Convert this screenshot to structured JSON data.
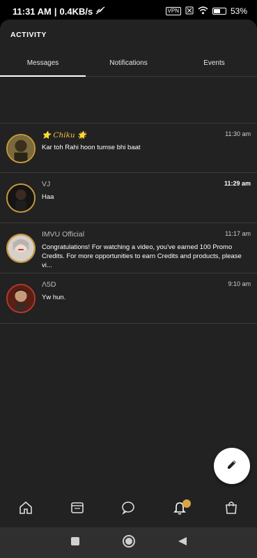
{
  "status_bar": {
    "time": "11:31 AM",
    "speed": "0.4KB/s",
    "vpn": "VPN",
    "battery": "53"
  },
  "header": {
    "title": "ACTIVITY"
  },
  "tabs": [
    {
      "label": "Messages",
      "active": true
    },
    {
      "label": "Notifications",
      "active": false
    },
    {
      "label": "Events",
      "active": false
    }
  ],
  "messages": [
    {
      "name": "⭐ Chiku 🌟",
      "time": "11:30 am",
      "text": "Kar toh Rahi hoon tumse bhi baat"
    },
    {
      "name": "VJ",
      "time": "11:29 am",
      "text": "Haa"
    },
    {
      "name": "IMVU Official",
      "time": "11:17 am",
      "text": "Congratulations! For watching a video, you've earned 100 Promo Credits. For more opportunities to earn Credits and products, please vi..."
    },
    {
      "name": "Λ5D",
      "time": "9:10 am",
      "text": "Yw hun."
    }
  ],
  "colors": {
    "accent": "#d9a441",
    "panel": "#222222",
    "avatar_border": "#c99a3b"
  }
}
